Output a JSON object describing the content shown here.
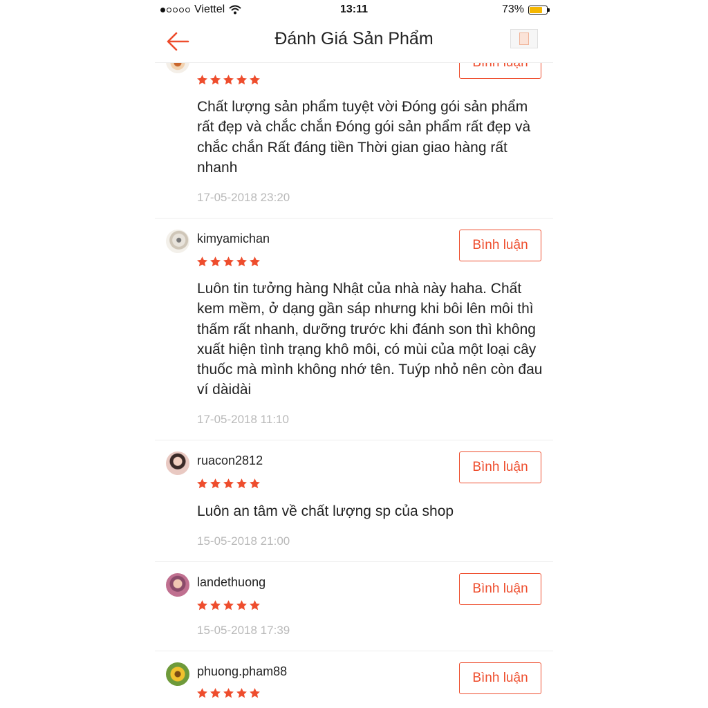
{
  "status_bar": {
    "carrier": "Viettel",
    "time": "13:11",
    "battery": "73%",
    "battery_level": 0.73,
    "signal_bars": 1
  },
  "header": {
    "title": "Đánh Giá Sản Phẩm",
    "back_icon": "back-arrow-icon",
    "product_thumb": "product-thumbnail"
  },
  "colors": {
    "accent": "#ee4d2d",
    "date_gray": "#b9b9b9"
  },
  "reviews": [
    {
      "username": "",
      "rating": 5,
      "text": "Chất lượng sản phẩm tuyệt vời Đóng gói sản phẩm rất đẹp và chắc chắn Đóng gói sản phẩm rất đẹp và chắc chắn Rất đáng tiền Thời gian giao hàng rất nhanh",
      "date": "17-05-2018 23:20",
      "button": "Bình luận"
    },
    {
      "username": "kimyamichan",
      "rating": 5,
      "text": "Luôn tin tưởng hàng Nhật của nhà này haha. Chất kem mềm, ở dạng gần sáp nhưng khi bôi lên môi thì thấm rất nhanh, dưỡng trước khi đánh son thì không xuất hiện tình trạng khô môi, có mùi của một loại cây thuốc mà mình không nhớ tên. Tuýp nhỏ nên còn đau ví dàidài",
      "date": "17-05-2018 11:10",
      "button": "Bình luận"
    },
    {
      "username": "ruacon2812",
      "rating": 5,
      "text": "Luôn an tâm về chất lượng sp của shop",
      "date": "15-05-2018 21:00",
      "button": "Bình luận"
    },
    {
      "username": "landethuong",
      "rating": 5,
      "text": "",
      "date": "15-05-2018 17:39",
      "button": "Bình luận"
    },
    {
      "username": "phuong.pham88",
      "rating": 5,
      "text": "",
      "date": "",
      "button": "Bình luận"
    }
  ]
}
